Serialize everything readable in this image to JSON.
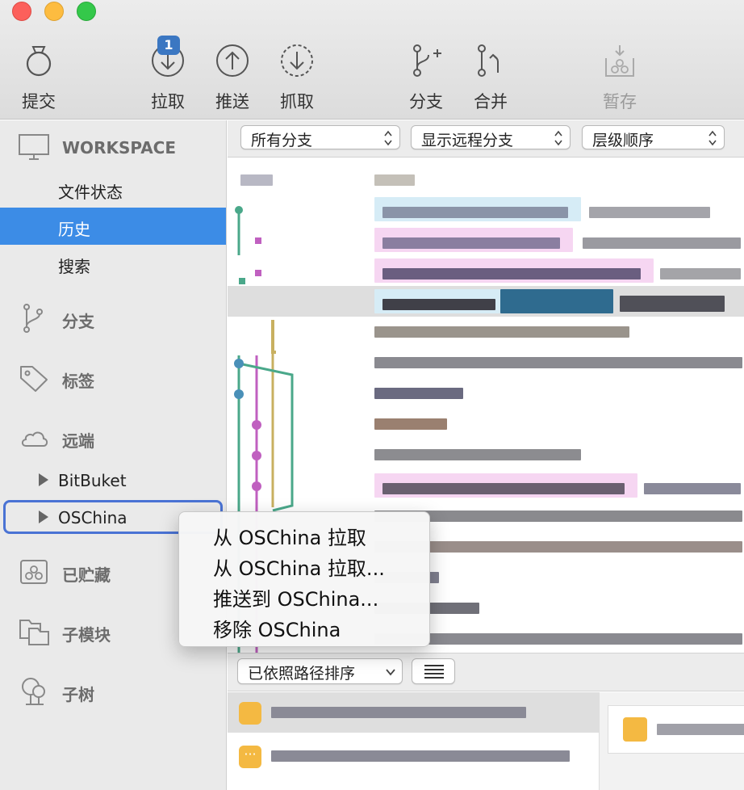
{
  "toolbar": {
    "buttons": [
      {
        "label": "提交",
        "icon": "commit-icon"
      },
      {
        "label": "拉取",
        "icon": "pull-icon",
        "badge": "1"
      },
      {
        "label": "推送",
        "icon": "push-icon"
      },
      {
        "label": "抓取",
        "icon": "fetch-icon"
      },
      {
        "label": "分支",
        "icon": "branch-icon"
      },
      {
        "label": "合并",
        "icon": "merge-icon"
      },
      {
        "label": "暂存",
        "icon": "stash-icon",
        "disabled": true
      }
    ]
  },
  "sidebar": {
    "workspace": {
      "label": "WORKSPACE",
      "icon": "monitor-icon"
    },
    "workspace_items": [
      "文件状态",
      "历史",
      "搜索"
    ],
    "selected_item": "历史",
    "sections": [
      {
        "label": "分支",
        "icon": "branch-icon"
      },
      {
        "label": "标签",
        "icon": "tag-icon"
      },
      {
        "label": "远端",
        "icon": "cloud-icon"
      }
    ],
    "remotes": [
      "BitBuket",
      "OSChina"
    ],
    "focused_remote": "OSChina",
    "bottom_sections": [
      {
        "label": "已贮藏",
        "icon": "stash-icon"
      },
      {
        "label": "子模块",
        "icon": "submodule-icon"
      },
      {
        "label": "子树",
        "icon": "subtree-icon"
      }
    ]
  },
  "filters": {
    "branch": "所有分支",
    "remote": "显示远程分支",
    "order": "层级顺序"
  },
  "bottom": {
    "sort": "已依照路径排序"
  },
  "context_menu": {
    "items": [
      "从 OSChina 拉取",
      "从 OSChina 拉取...",
      "推送到 OSChina...",
      "移除 OSChina"
    ]
  },
  "colors": {
    "selection": "#3c8ce6",
    "badge": "#3b77c2",
    "graph_teal": "#4aa88a",
    "graph_magenta": "#c060c0",
    "graph_olive": "#c8b060"
  }
}
